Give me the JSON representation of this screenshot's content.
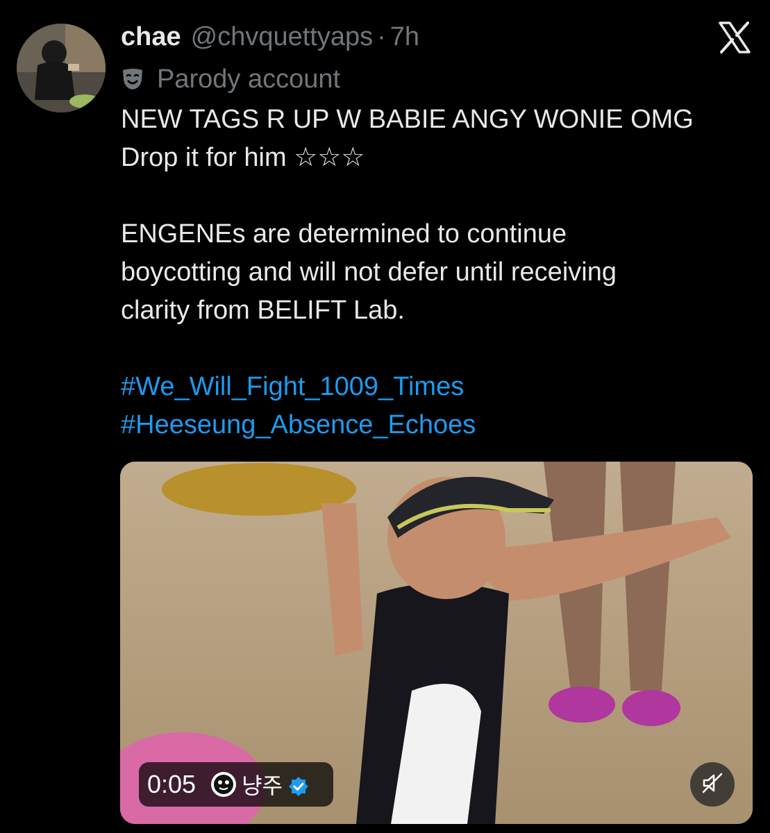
{
  "tweet": {
    "display_name": "chae",
    "handle": "@chvquettyaps",
    "separator": "·",
    "time": "7h",
    "label": "Parody account",
    "lines": [
      "NEW TAGS R UP W BABIE ANGY WONIE OMG",
      "Drop it for him ☆☆☆",
      "",
      "ENGENEs are determined to continue",
      "boycotting and will not defer until receiving",
      "clarity from BELIFT Lab.",
      ""
    ],
    "hashtags": [
      "#We_Will_Fight_1009_Times",
      "#Heeseung_Absence_Echoes"
    ]
  },
  "media": {
    "duration": "0:05",
    "uploader": "냥주"
  },
  "icons": {
    "close": "x-logo-icon",
    "parody": "theater-mask-icon",
    "verified": "verified-badge-icon",
    "mute": "speaker-muted-icon"
  },
  "colors": {
    "background": "#000000",
    "text": "#e7e9ea",
    "secondary": "#71767b",
    "link": "#1d9bf0",
    "verified": "#1d9bf0"
  }
}
